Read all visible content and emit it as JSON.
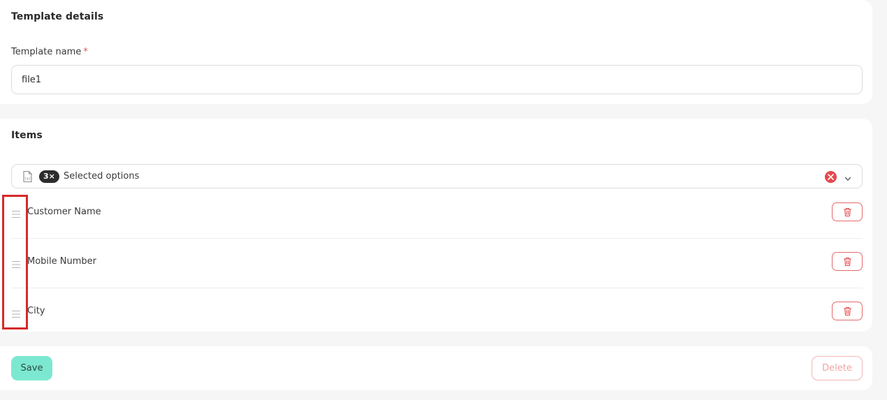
{
  "template_details": {
    "title": "Template details",
    "name_label": "Template name",
    "required_marker": "*",
    "name_value": "file1"
  },
  "items_section": {
    "title": "Items",
    "selector": {
      "icon": "txt-file-icon",
      "count_badge": "3×",
      "text": "Selected options"
    },
    "items": [
      {
        "label": "Customer Name"
      },
      {
        "label": "Mobile Number"
      },
      {
        "label": "City"
      }
    ]
  },
  "footer": {
    "save_label": "Save",
    "delete_label": "Delete"
  },
  "colors": {
    "accent": "#7de8d1",
    "danger": "#e5484d",
    "highlight": "#d62a2a",
    "background": "#f6f6f6"
  }
}
